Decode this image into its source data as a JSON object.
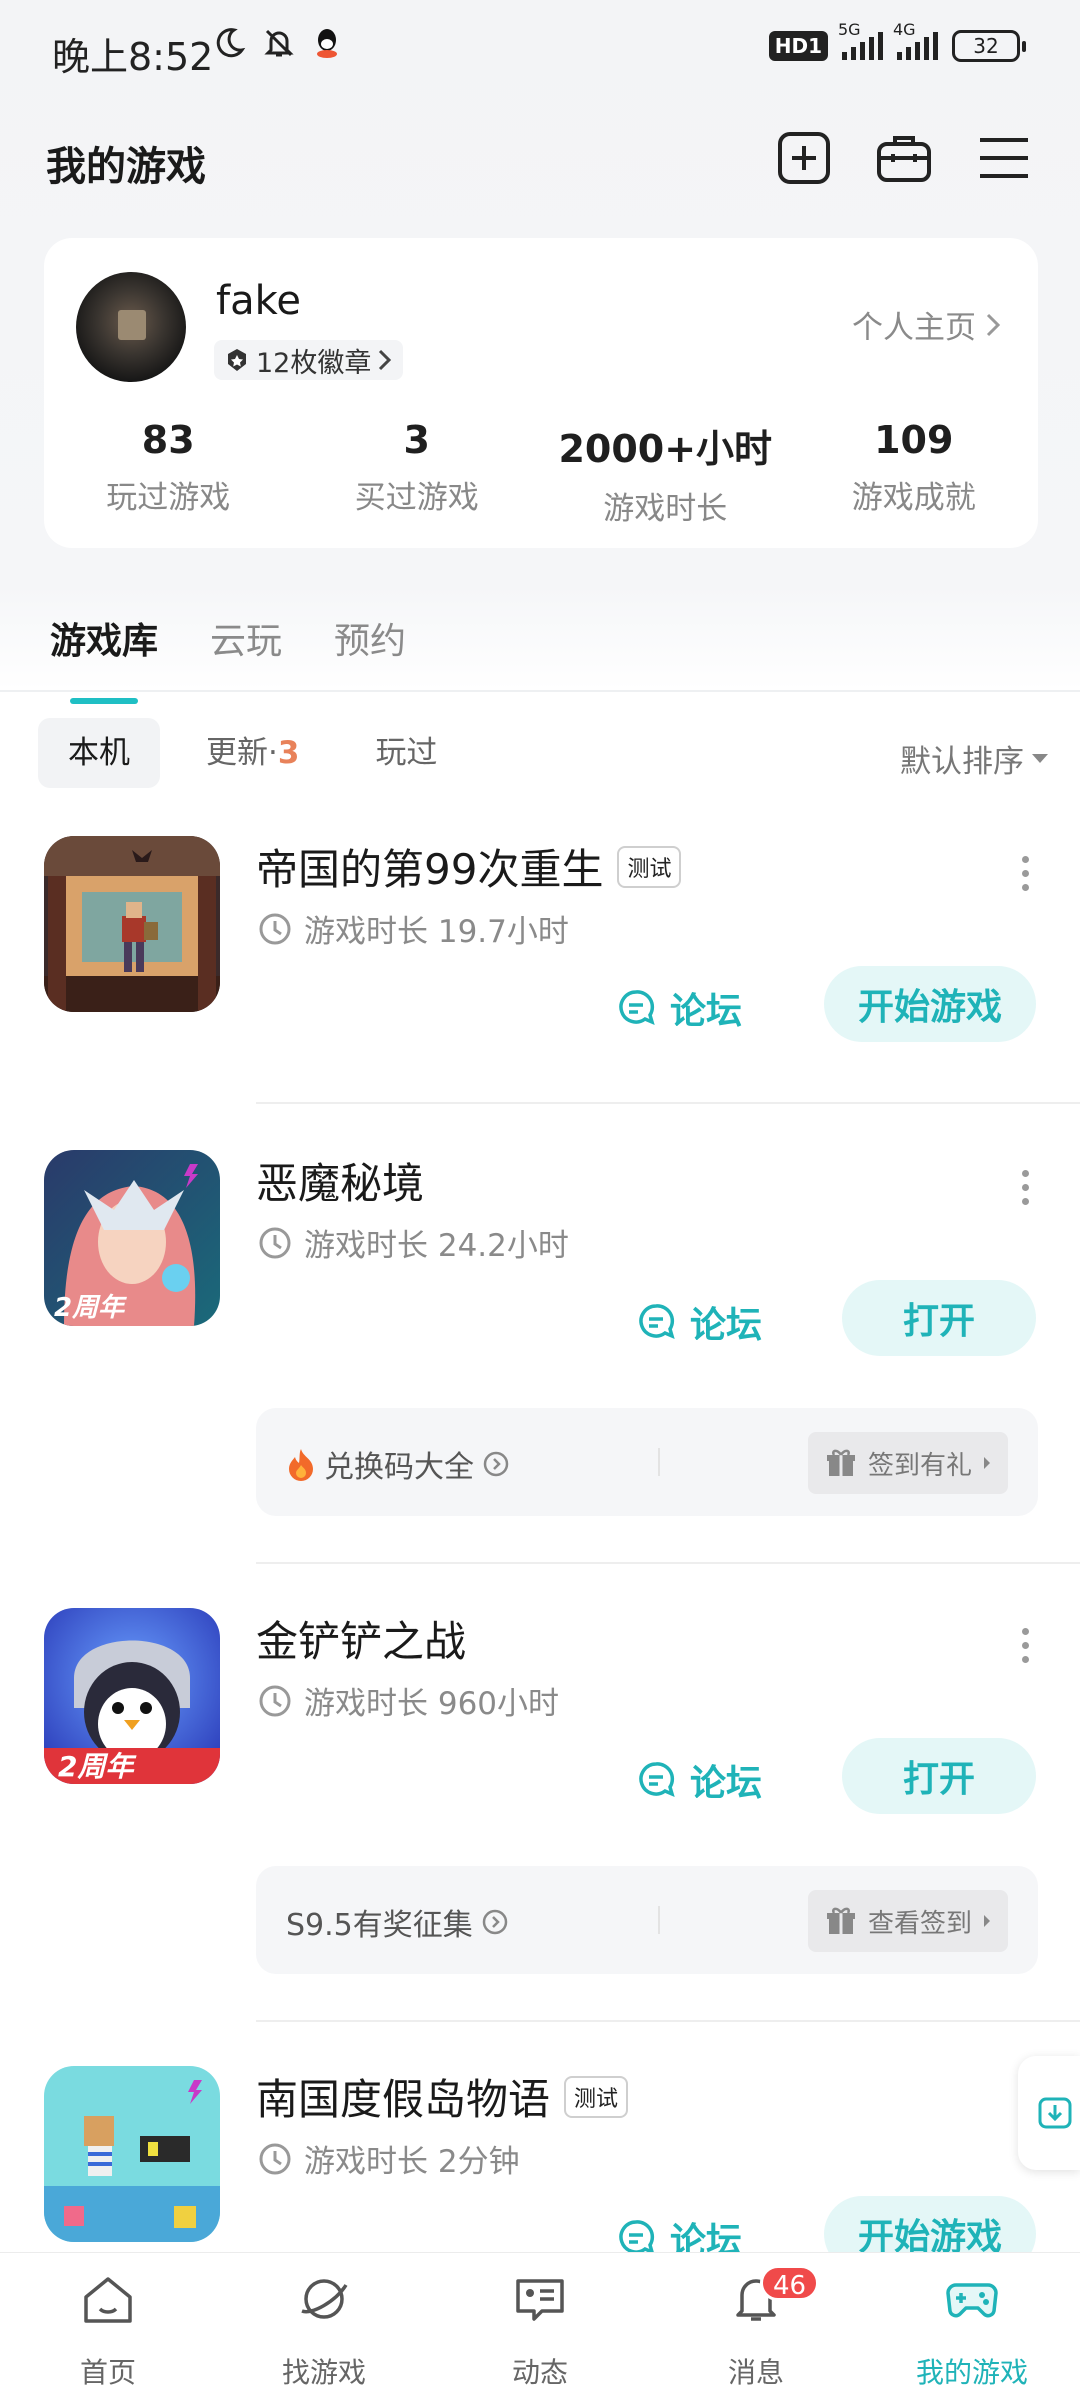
{
  "status_bar": {
    "time": "晚上8:52",
    "hd": "HD1",
    "net1": "5G",
    "net2": "4G",
    "battery": "32"
  },
  "header": {
    "title": "我的游戏"
  },
  "profile": {
    "name": "fake",
    "badges": "12枚徽章",
    "home_link": "个人主页",
    "stats": [
      {
        "value": "83",
        "label": "玩过游戏"
      },
      {
        "value": "3",
        "label": "买过游戏"
      },
      {
        "value": "2000+小时",
        "label": "游戏时长"
      },
      {
        "value": "109",
        "label": "游戏成就"
      }
    ]
  },
  "tabs": [
    "游戏库",
    "云玩",
    "预约"
  ],
  "filters": {
    "local": "本机",
    "update": "更新",
    "update_count": "3",
    "played": "玩过",
    "sort": "默认排序"
  },
  "games": [
    {
      "name": "帝国的第99次重生",
      "tag": "测试",
      "time": "游戏时长 19.7小时",
      "forum": "论坛",
      "action": "开始游戏"
    },
    {
      "name": "恶魔秘境",
      "time": "游戏时长 24.2小时",
      "forum": "论坛",
      "action": "打开",
      "promo_left": "兑换码大全",
      "promo_right": "签到有礼",
      "icon_badge": "2周年"
    },
    {
      "name": "金铲铲之战",
      "time": "游戏时长 960小时",
      "forum": "论坛",
      "action": "打开",
      "promo_left": "S9.5有奖征集",
      "promo_right": "查看签到",
      "icon_badge": "2周年"
    },
    {
      "name": "南国度假岛物语",
      "tag": "测试",
      "time": "游戏时长 2分钟",
      "forum": "论坛",
      "action": "开始游戏"
    }
  ],
  "bottom_nav": [
    {
      "label": "首页"
    },
    {
      "label": "找游戏"
    },
    {
      "label": "动态"
    },
    {
      "label": "消息",
      "badge": "46"
    },
    {
      "label": "我的游戏"
    }
  ],
  "colors": {
    "accent": "#1fb3b8",
    "accent_light": "#e4f7f7",
    "badge_red": "#f04a4a",
    "update_orange": "#e8825a"
  }
}
